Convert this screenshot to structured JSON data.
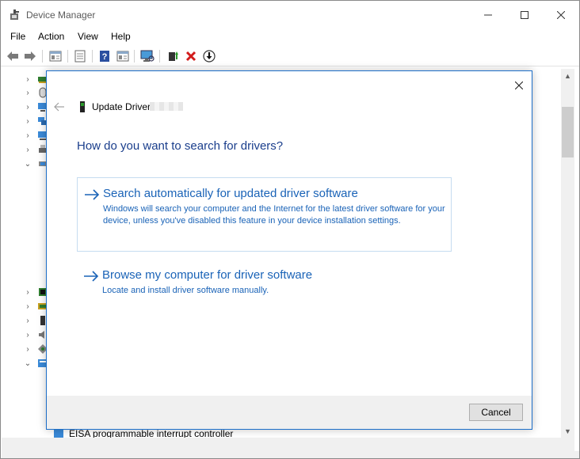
{
  "window": {
    "title": "Device Manager"
  },
  "menu": {
    "items": [
      "File",
      "Action",
      "View",
      "Help"
    ]
  },
  "toolbar": {
    "icons": [
      "back-arrow-icon",
      "forward-arrow-icon",
      "properties-icon",
      "view-icon",
      "help-icon",
      "action-view-icon",
      "monitor-icon",
      "update-driver-icon",
      "uninstall-icon",
      "disable-device-icon"
    ]
  },
  "tree": {
    "bottom_item": "EISA programmable interrupt controller"
  },
  "dialog": {
    "title": "Update Driver",
    "heading": "How do you want to search for drivers?",
    "option_auto": {
      "title": "Search automatically for updated driver software",
      "description": "Windows will search your computer and the Internet for the latest driver software for your device, unless you've disabled this feature in your device installation settings."
    },
    "option_browse": {
      "title": "Browse my computer for driver software",
      "description": "Locate and install driver software manually."
    },
    "cancel_label": "Cancel"
  },
  "colors": {
    "accent": "#1a63b7",
    "heading": "#1a3e8c",
    "dialog_border": "#1c6ec8"
  }
}
